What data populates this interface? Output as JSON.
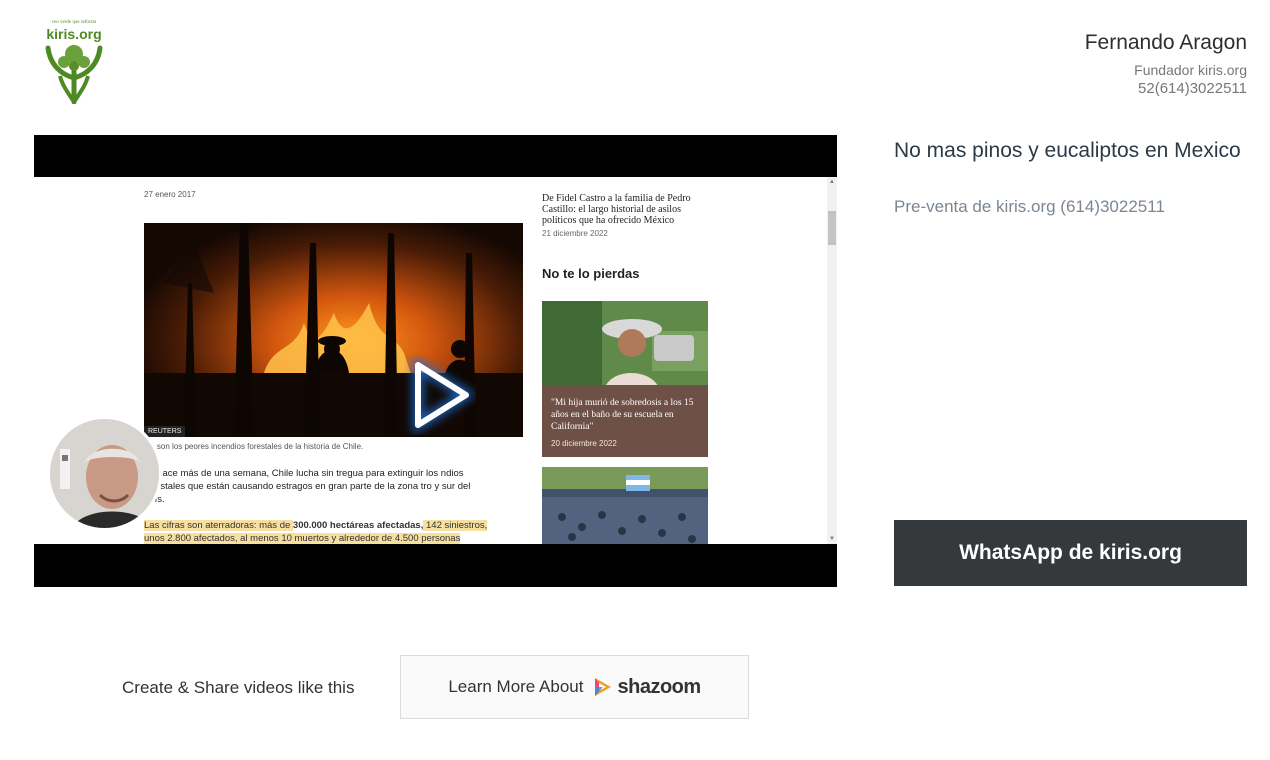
{
  "brand": {
    "logo_tagline": "ceo verde que reforsta",
    "logo_name": "kiris.org",
    "logo_icon": "tree-person-icon",
    "accent": "#4e8a24"
  },
  "contact": {
    "name": "Fernando Aragon",
    "role": "Fundador kiris.org",
    "phone": "52(614)3022511"
  },
  "video": {
    "article": {
      "date": "27 enero 2017",
      "photo_credit": "REUTERS",
      "caption": "tos son los peores incendios forestales de la historia de Chile.",
      "body": "de hace más de una semana, Chile lucha sin tregua para extinguir los ndios forestales que están causando estragos en gran parte de la zona tro y sur del país.",
      "highlight_pre": "Las cifras son aterradoras: más de ",
      "highlight_bold": "300.000 hectáreas afectadas,",
      "highlight_post": " 142 siniestros, unos 2.800 afectados, al menos 10 muertos y alrededor de 4.500 personas"
    },
    "sidebar": {
      "headline": "De Fidel Castro a la familia de Pedro Castillo: el largo historial de asilos políticos que ha ofrecido México",
      "headline_date": "21 diciembre 2022",
      "section_title": "No te lo pierdas",
      "card1_title": "\"Mi hija murió de sobredosis a los 15 años en el baño de su escuela en California\"",
      "card1_date": "20 diciembre 2022"
    },
    "play_icon": "play-icon"
  },
  "panel": {
    "title": "No mas pinos y eucaliptos en Mexico",
    "subtitle": "Pre-venta de kiris.org (614)3022511",
    "whatsapp_label": "WhatsApp de kiris.org",
    "button_color": "#36393b"
  },
  "footer": {
    "create_text": "Create & Share videos like this",
    "learn_label": "Learn More About",
    "shazoom_name": "shazoom"
  }
}
